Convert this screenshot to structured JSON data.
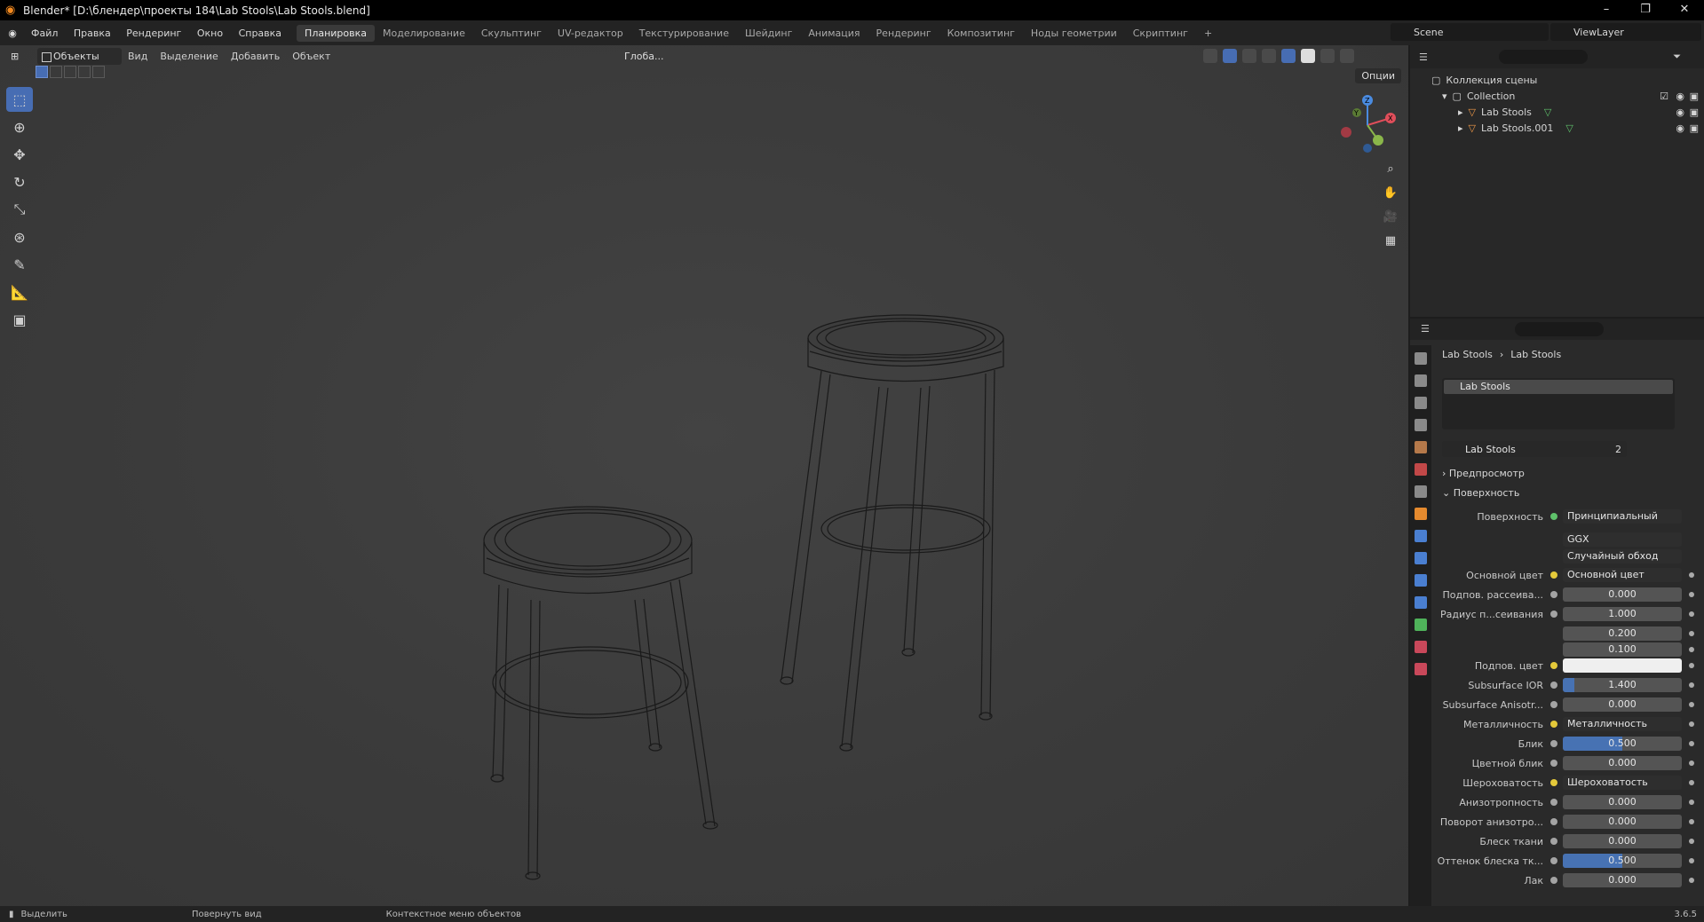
{
  "window": {
    "title": "Blender* [D:\\блендер\\проекты 184\\Lab Stools\\Lab Stools.blend]"
  },
  "menu": [
    "Файл",
    "Правка",
    "Рендеринг",
    "Окно",
    "Справка"
  ],
  "workspaces": [
    "Планировка",
    "Моделирование",
    "Скульптинг",
    "UV-редактор",
    "Текстурирование",
    "Шейдинг",
    "Анимация",
    "Рендеринг",
    "Композитинг",
    "Ноды геометрии",
    "Скриптинг",
    "+"
  ],
  "scene": "Scene",
  "view_layer": "ViewLayer",
  "viewport": {
    "mode": "Объекты",
    "menus": [
      "Вид",
      "Выделение",
      "Добавить",
      "Объект"
    ],
    "orientation": "Глоба...",
    "options": "Опции",
    "gizmo_axes": [
      "X",
      "Y",
      "Z"
    ]
  },
  "outliner": {
    "root": "Коллекция сцены",
    "collection": "Collection",
    "objects": [
      "Lab Stools",
      "Lab Stools.001"
    ]
  },
  "properties": {
    "breadcrumb_object": "Lab Stools",
    "breadcrumb_material": "Lab Stools",
    "slot": "Lab Stools",
    "material_name": "Lab Stools",
    "users": "2",
    "section_preview": "Предпросмотр",
    "section_surface": "Поверхность",
    "surface_label": "Поверхность",
    "surface_value": "Принципиальный BSDF",
    "distribution": "GGX",
    "subsurface_method": "Случайный обход",
    "rows": [
      {
        "label": "Основной цвет",
        "value": "Основной цвет",
        "kind": "link"
      },
      {
        "label": "Подпов. рассеива...",
        "value": "0.000",
        "kind": "num"
      },
      {
        "label": "Радиус п...сеивания",
        "value": "1.000",
        "kind": "num"
      },
      {
        "label": "",
        "value": "0.200",
        "kind": "num"
      },
      {
        "label": "",
        "value": "0.100",
        "kind": "num"
      },
      {
        "label": "Подпов. цвет",
        "value": "",
        "kind": "color"
      },
      {
        "label": "Subsurface IOR",
        "value": "1.400",
        "kind": "num",
        "fill": 0.1
      },
      {
        "label": "Subsurface Anisotr...",
        "value": "0.000",
        "kind": "num"
      },
      {
        "label": "Металличность",
        "value": "Металличность",
        "kind": "link"
      },
      {
        "label": "Блик",
        "value": "0.500",
        "kind": "num",
        "fill": 0.5
      },
      {
        "label": "Цветной блик",
        "value": "0.000",
        "kind": "num"
      },
      {
        "label": "Шероховатость",
        "value": "Шероховатость",
        "kind": "link"
      },
      {
        "label": "Анизотропность",
        "value": "0.000",
        "kind": "num"
      },
      {
        "label": "Поворот анизотро...",
        "value": "0.000",
        "kind": "num"
      },
      {
        "label": "Блеск ткани",
        "value": "0.000",
        "kind": "num"
      },
      {
        "label": "Оттенок блеска тк...",
        "value": "0.500",
        "kind": "num",
        "fill": 0.5
      },
      {
        "label": "Лак",
        "value": "0.000",
        "kind": "num"
      }
    ]
  },
  "status": {
    "select": "Выделить",
    "rotate": "Повернуть вид",
    "context": "Контекстное меню объектов",
    "version": "3.6.5"
  }
}
